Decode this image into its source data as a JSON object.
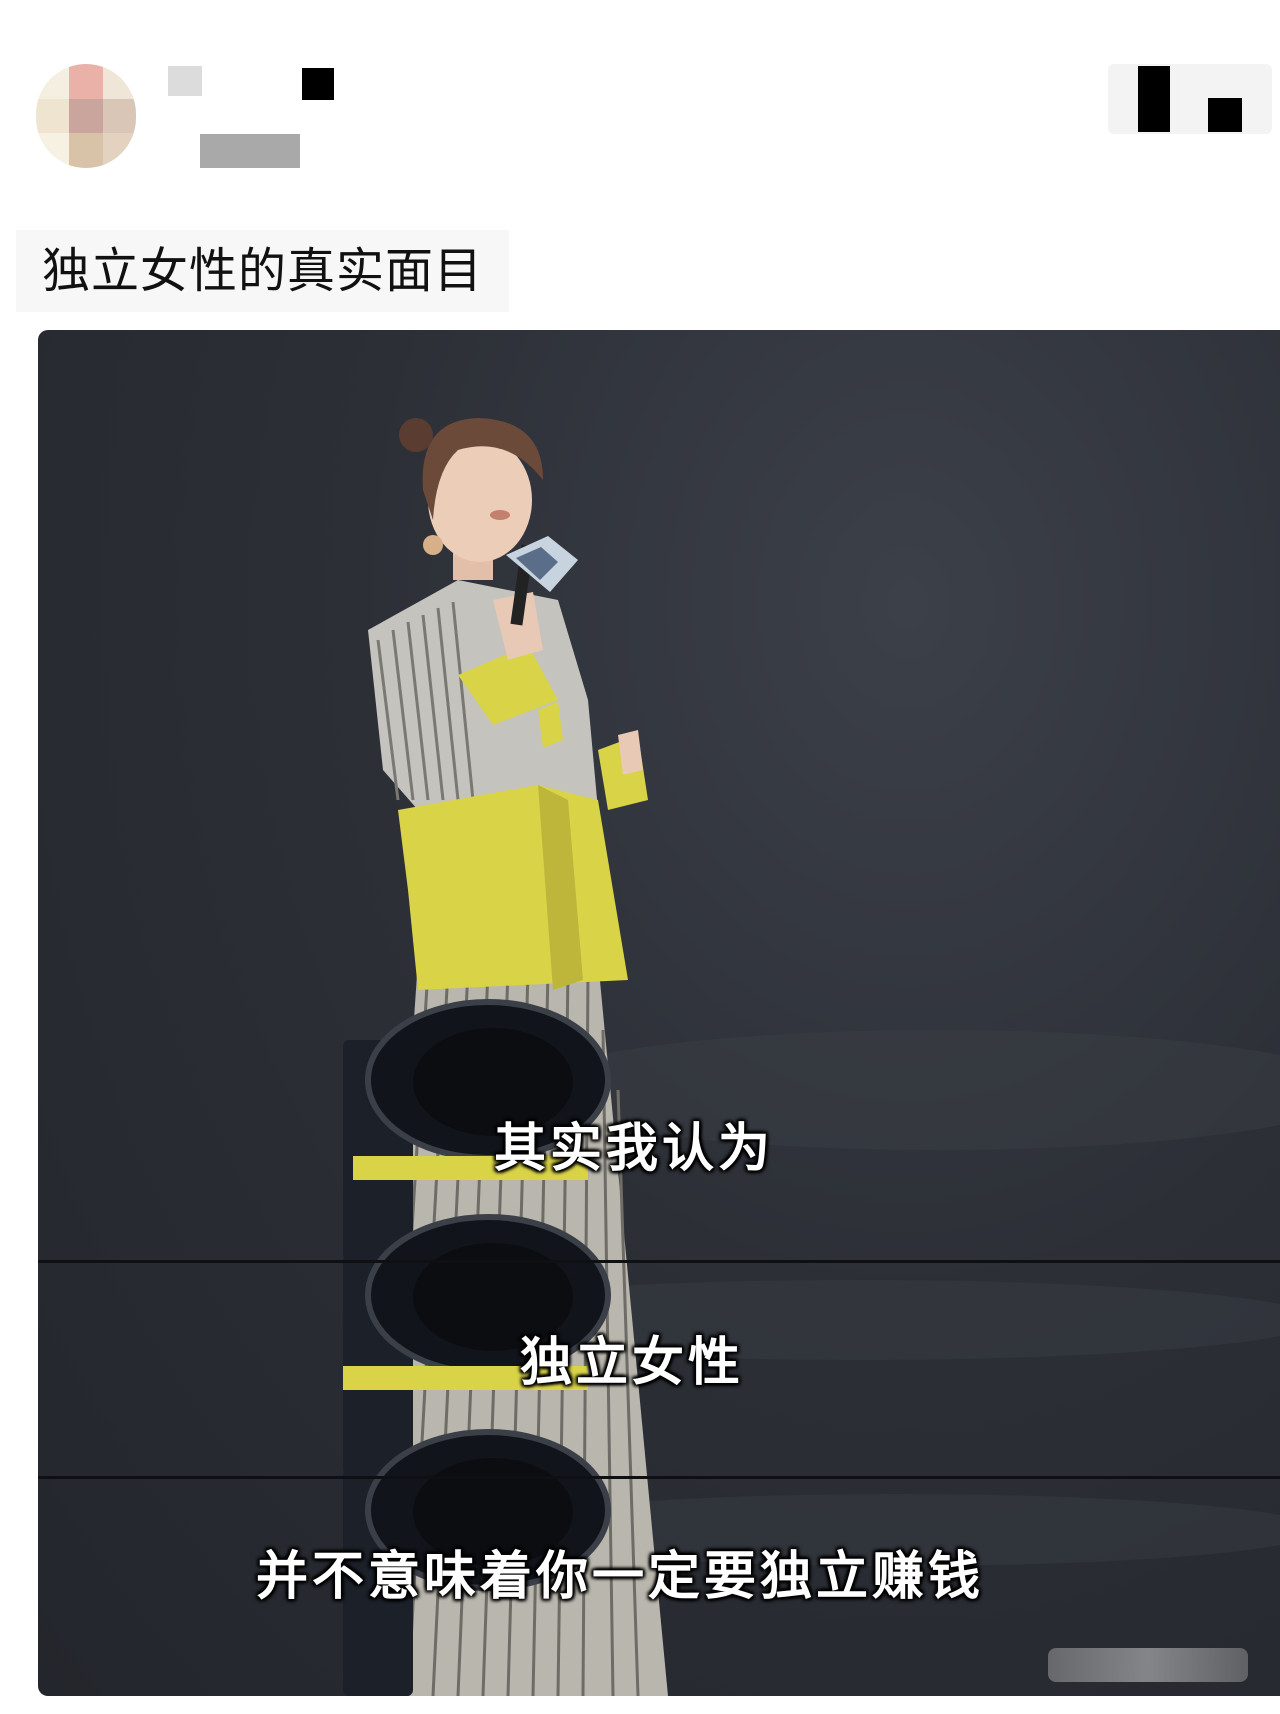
{
  "post": {
    "title": "独立女性的真实面目"
  },
  "media": {
    "subtitles": [
      "其实我认为",
      "独立女性",
      "并不意味着你一定要独立赚钱"
    ]
  },
  "colors": {
    "jacket_yellow": "#d9d347",
    "stage_background": "#2c2f36",
    "subtitle_text": "#ffffff"
  },
  "icons": {
    "avatar": "pixelated-avatar",
    "name": "redacted-username",
    "follow": "redacted-follow-button",
    "watermark": "blurred-watermark"
  }
}
